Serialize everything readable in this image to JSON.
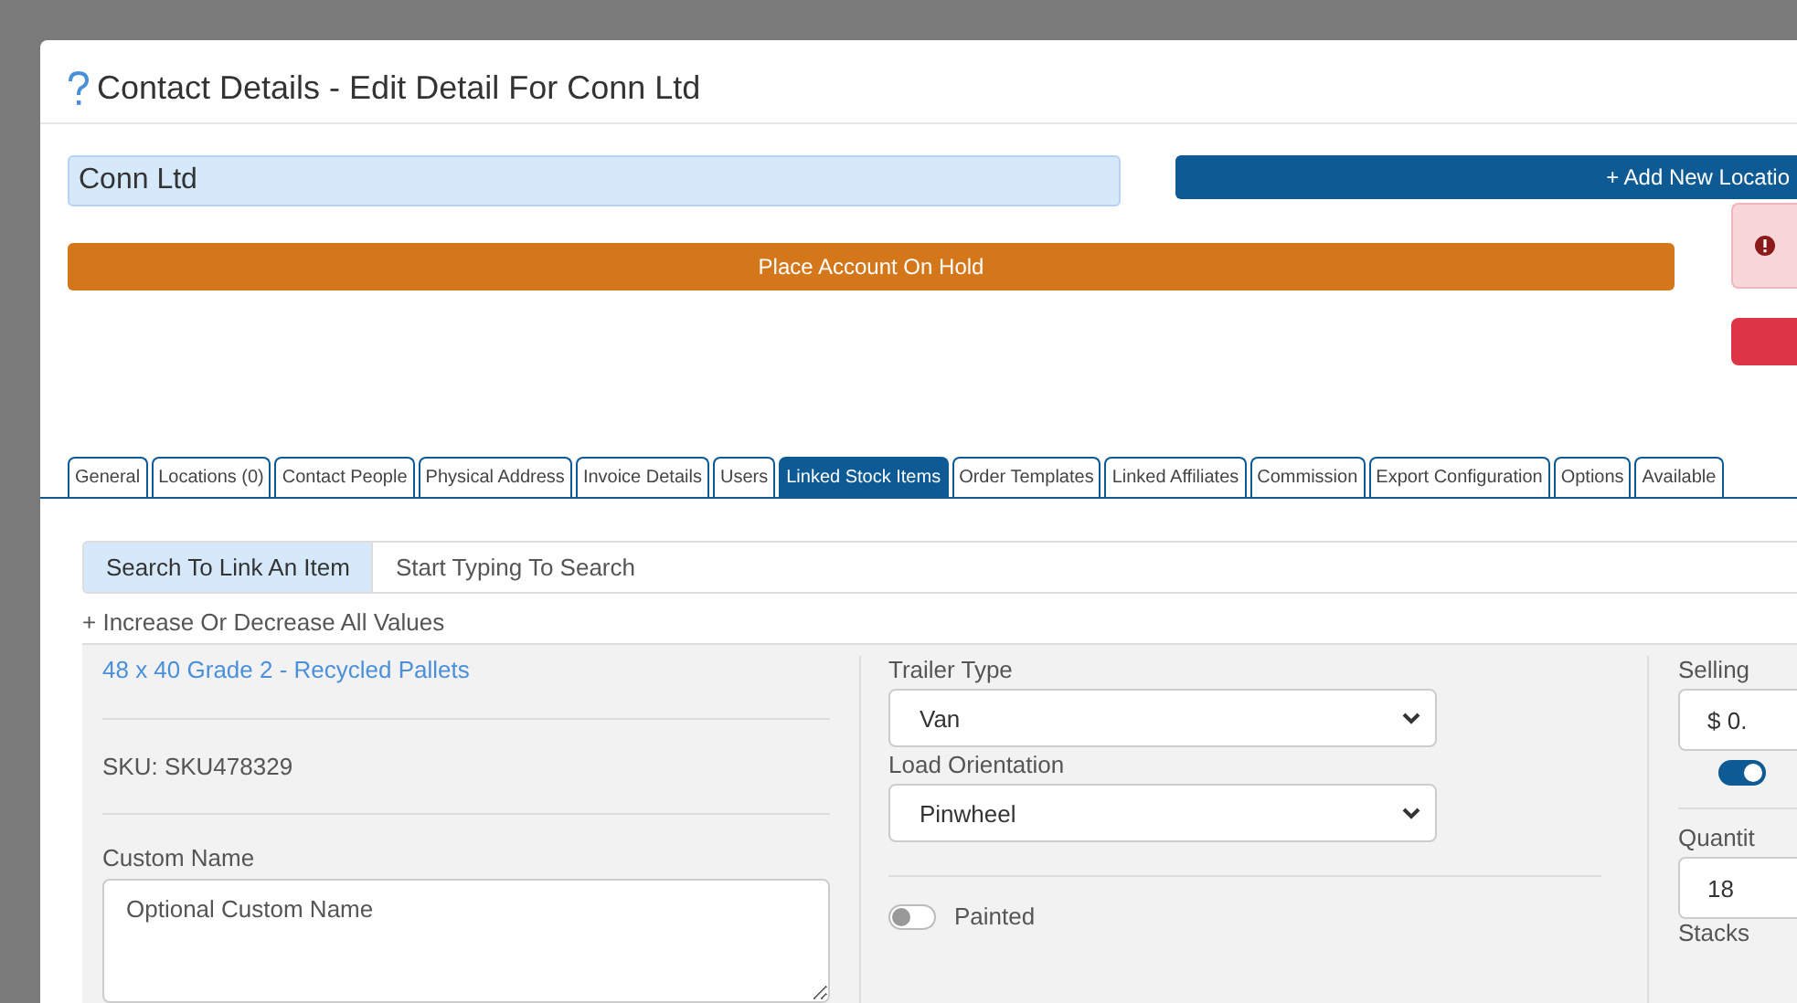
{
  "window": {
    "title": "Contact Details - Edit Detail For Conn Ltd"
  },
  "contact_name": {
    "value": "Conn Ltd"
  },
  "add_location_button": "+ Add New Locatio",
  "hold_button": "Place Account On Hold",
  "tabs": [
    {
      "label": "General",
      "selected": false
    },
    {
      "label": "Locations (0)",
      "selected": false
    },
    {
      "label": "Contact People",
      "selected": false
    },
    {
      "label": "Physical Address",
      "selected": false
    },
    {
      "label": "Invoice Details",
      "selected": false
    },
    {
      "label": "Users",
      "selected": false
    },
    {
      "label": "Linked Stock Items",
      "selected": true
    },
    {
      "label": "Order Templates",
      "selected": false
    },
    {
      "label": "Linked Affiliates",
      "selected": false
    },
    {
      "label": "Commission",
      "selected": false
    },
    {
      "label": "Export Configuration",
      "selected": false
    },
    {
      "label": "Options",
      "selected": false
    },
    {
      "label": "Available",
      "selected": false
    }
  ],
  "search": {
    "label": "Search To Link An Item",
    "placeholder": "Start Typing To Search"
  },
  "adjust_link": "+ Increase Or Decrease All Values",
  "item": {
    "name": "48 x 40 Grade 2 - Recycled Pallets",
    "sku": "SKU: SKU478329",
    "custom_name": {
      "label": "Custom Name",
      "placeholder": "Optional Custom Name"
    },
    "trailer_type": {
      "label": "Trailer Type",
      "value": "Van"
    },
    "load_orientation": {
      "label": "Load Orientation",
      "value": "Pinwheel"
    },
    "painted": {
      "label": "Painted",
      "on": false
    },
    "selling_price": {
      "label": "Selling",
      "value": "$ 0."
    },
    "price_toggle": {
      "on": true
    },
    "quantity": {
      "label": "Quantit",
      "value": "18"
    },
    "stacks": {
      "label": "Stacks"
    }
  }
}
